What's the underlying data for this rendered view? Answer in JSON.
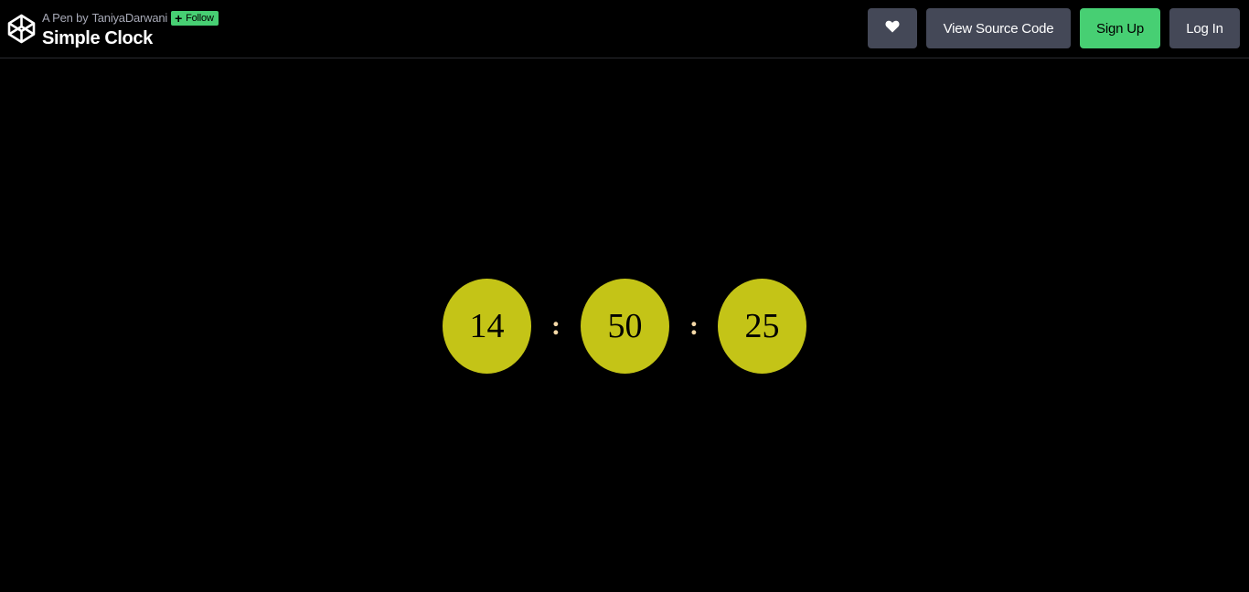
{
  "header": {
    "byline_prefix": "A Pen by",
    "author": "TaniyaDarwani",
    "follow_label": "Follow",
    "title": "Simple Clock",
    "logo_icon": "codepen-logo-icon"
  },
  "actions": {
    "heart_icon": "heart-icon",
    "view_source_label": "View Source Code",
    "signup_label": "Sign Up",
    "login_label": "Log In"
  },
  "clock": {
    "hours": "14",
    "minutes": "50",
    "seconds": "25",
    "separator": ":"
  },
  "colors": {
    "background": "#000000",
    "button_dark": "#444857",
    "accent_green": "#47cf73",
    "bubble": "#c4c417",
    "separator": "#f5d9a8"
  }
}
